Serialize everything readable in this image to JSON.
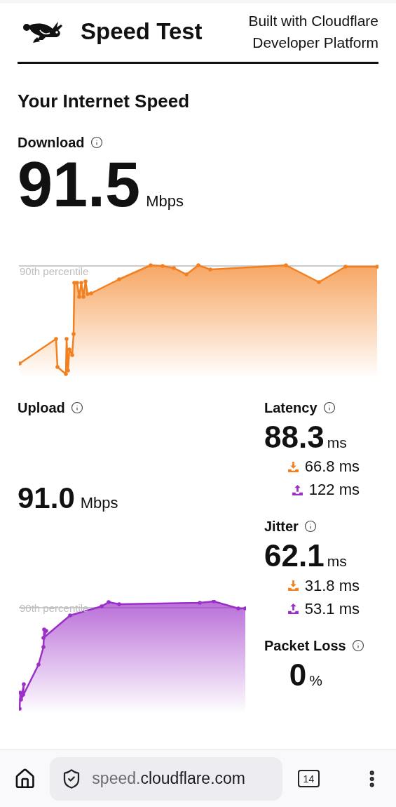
{
  "header": {
    "title": "Speed Test",
    "tagline_lines": [
      "Built with Cloudflare",
      "Developer Platform"
    ]
  },
  "heading": "Your Internet Speed",
  "download": {
    "label": "Download",
    "value": "91.5",
    "unit": "Mbps",
    "chart_label": "90th percentile"
  },
  "upload": {
    "label": "Upload",
    "value": "91.0",
    "unit": "Mbps",
    "chart_label": "90th percentile"
  },
  "metrics": [
    {
      "label": "Latency",
      "value": "88.3",
      "unit": "ms",
      "breakdown": [
        {
          "kind": "download",
          "value": "66.8 ms"
        },
        {
          "kind": "upload",
          "value": "122 ms"
        }
      ]
    },
    {
      "label": "Jitter",
      "value": "62.1",
      "unit": "ms",
      "breakdown": [
        {
          "kind": "download",
          "value": "31.8 ms"
        },
        {
          "kind": "upload",
          "value": "53.1 ms"
        }
      ]
    },
    {
      "label": "Packet Loss",
      "value": "0",
      "unit": "%"
    }
  ],
  "browser_bar": {
    "url_subdomain": "speed.",
    "url_domain": "cloudflare.com",
    "tab_count": "14"
  }
}
